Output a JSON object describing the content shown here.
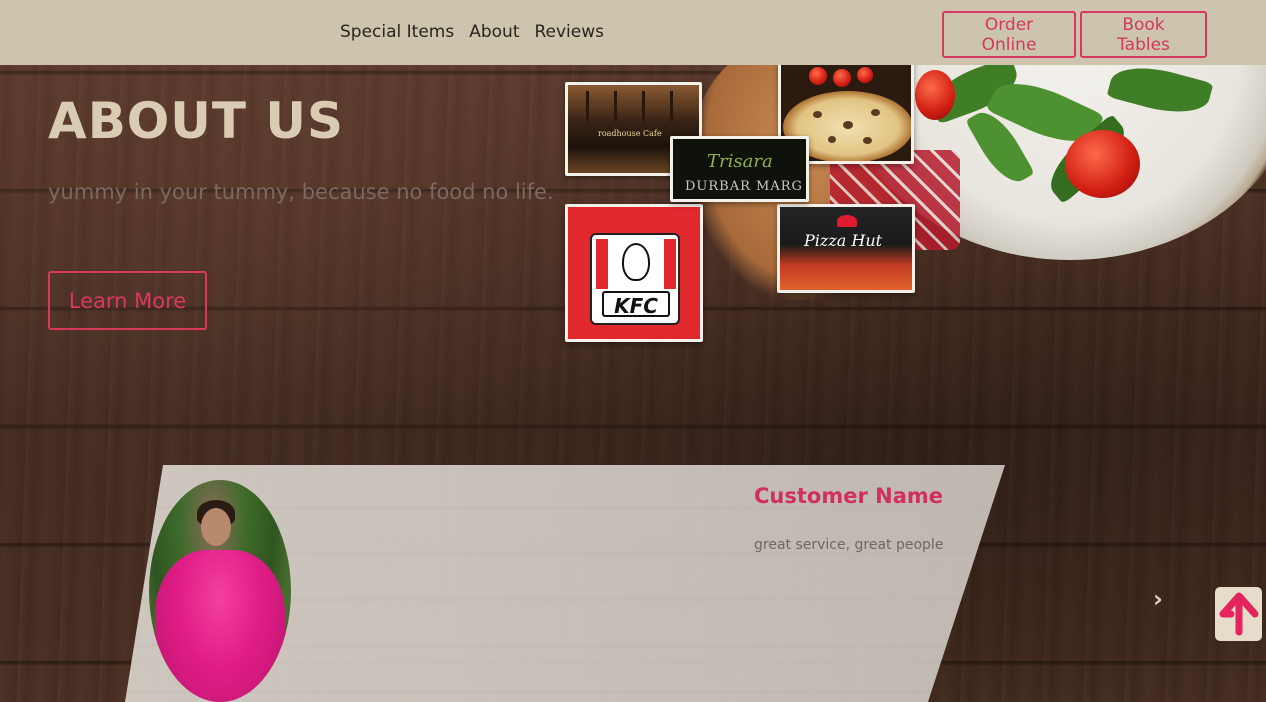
{
  "nav": {
    "links": [
      "Special Items",
      "About",
      "Reviews"
    ],
    "order_label": "Order Online",
    "book_label": "Book Tables"
  },
  "hero": {
    "title": "ABOUT US",
    "subtitle": "yummy in your tummy, because no food no life.",
    "learn_more": "Learn More"
  },
  "tiles": {
    "roadhouse_sign": "roadhouse Cafe",
    "trisara_name": "Trisara",
    "trisara_sub": "DURBAR MARG",
    "kfc_text": "KFC",
    "pizzahut_text": "Pizza Hut"
  },
  "review": {
    "customer_name": "Customer Name",
    "text": "great service, great people"
  },
  "controls": {
    "next_icon": "chevron-right-icon",
    "back_to_top_icon": "arrow-up-icon"
  },
  "colors": {
    "navbar_bg": "#cdc4ad",
    "accent": "#d9385e",
    "hero_title": "#d9ccb2"
  }
}
